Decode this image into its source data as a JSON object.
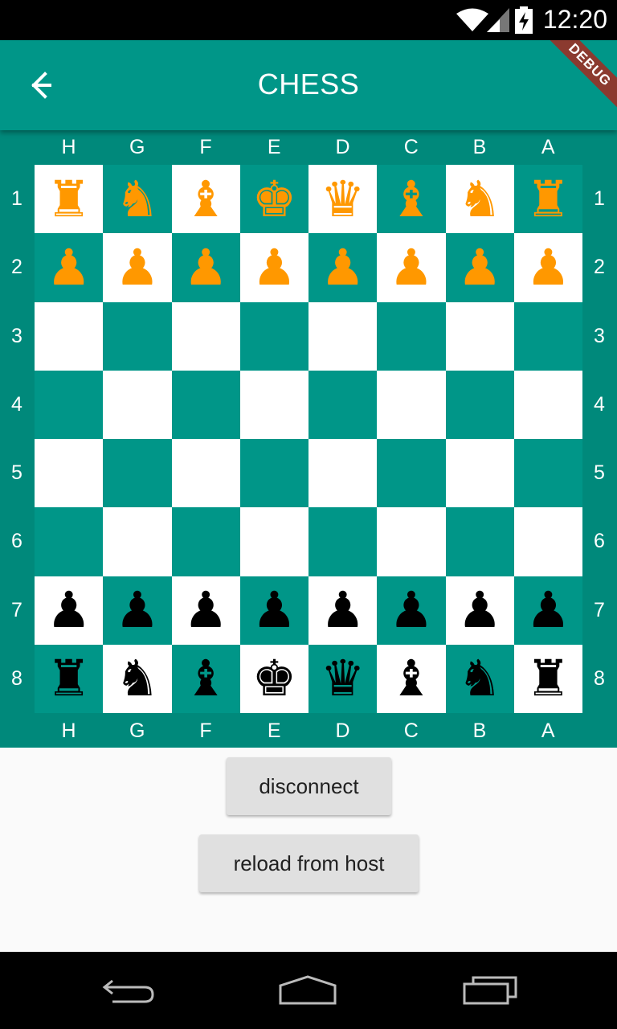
{
  "status_bar": {
    "time": "12:20",
    "icons": [
      "wifi-icon",
      "signal-icon",
      "battery-charging-icon"
    ]
  },
  "app_bar": {
    "title": "CHESS",
    "back_icon": "arrow-back-icon",
    "debug_banner": "DEBUG",
    "color": "#009688"
  },
  "board": {
    "files_top": [
      "H",
      "G",
      "F",
      "E",
      "D",
      "C",
      "B",
      "A"
    ],
    "files_bottom": [
      "H",
      "G",
      "F",
      "E",
      "D",
      "C",
      "B",
      "A"
    ],
    "ranks_left": [
      "1",
      "2",
      "3",
      "4",
      "5",
      "6",
      "7",
      "8"
    ],
    "ranks_right": [
      "1",
      "2",
      "3",
      "4",
      "5",
      "6",
      "7",
      "8"
    ],
    "colors": {
      "light": "#ffffff",
      "dark": "#009688",
      "frame": "#00897b",
      "orange_piece": "#ff9800",
      "black_piece": "#000000"
    },
    "rows": [
      [
        [
          "rook",
          "orange"
        ],
        [
          "knight",
          "orange"
        ],
        [
          "bishop",
          "orange"
        ],
        [
          "king",
          "orange"
        ],
        [
          "queen",
          "orange"
        ],
        [
          "bishop",
          "orange"
        ],
        [
          "knight",
          "orange"
        ],
        [
          "rook",
          "orange"
        ]
      ],
      [
        [
          "pawn",
          "orange"
        ],
        [
          "pawn",
          "orange"
        ],
        [
          "pawn",
          "orange"
        ],
        [
          "pawn",
          "orange"
        ],
        [
          "pawn",
          "orange"
        ],
        [
          "pawn",
          "orange"
        ],
        [
          "pawn",
          "orange"
        ],
        [
          "pawn",
          "orange"
        ]
      ],
      [
        null,
        null,
        null,
        null,
        null,
        null,
        null,
        null
      ],
      [
        null,
        null,
        null,
        null,
        null,
        null,
        null,
        null
      ],
      [
        null,
        null,
        null,
        null,
        null,
        null,
        null,
        null
      ],
      [
        null,
        null,
        null,
        null,
        null,
        null,
        null,
        null
      ],
      [
        [
          "pawn",
          "black"
        ],
        [
          "pawn",
          "black"
        ],
        [
          "pawn",
          "black"
        ],
        [
          "pawn",
          "black"
        ],
        [
          "pawn",
          "black"
        ],
        [
          "pawn",
          "black"
        ],
        [
          "pawn",
          "black"
        ],
        [
          "pawn",
          "black"
        ]
      ],
      [
        [
          "rook",
          "black"
        ],
        [
          "knight",
          "black"
        ],
        [
          "bishop",
          "black"
        ],
        [
          "king",
          "black"
        ],
        [
          "queen",
          "black"
        ],
        [
          "bishop",
          "black"
        ],
        [
          "knight",
          "black"
        ],
        [
          "rook",
          "black"
        ]
      ]
    ]
  },
  "actions": {
    "disconnect_label": "disconnect",
    "reload_label": "reload from host"
  },
  "nav_bar": {
    "icons": [
      "back-nav-icon",
      "home-nav-icon",
      "recents-nav-icon"
    ]
  }
}
